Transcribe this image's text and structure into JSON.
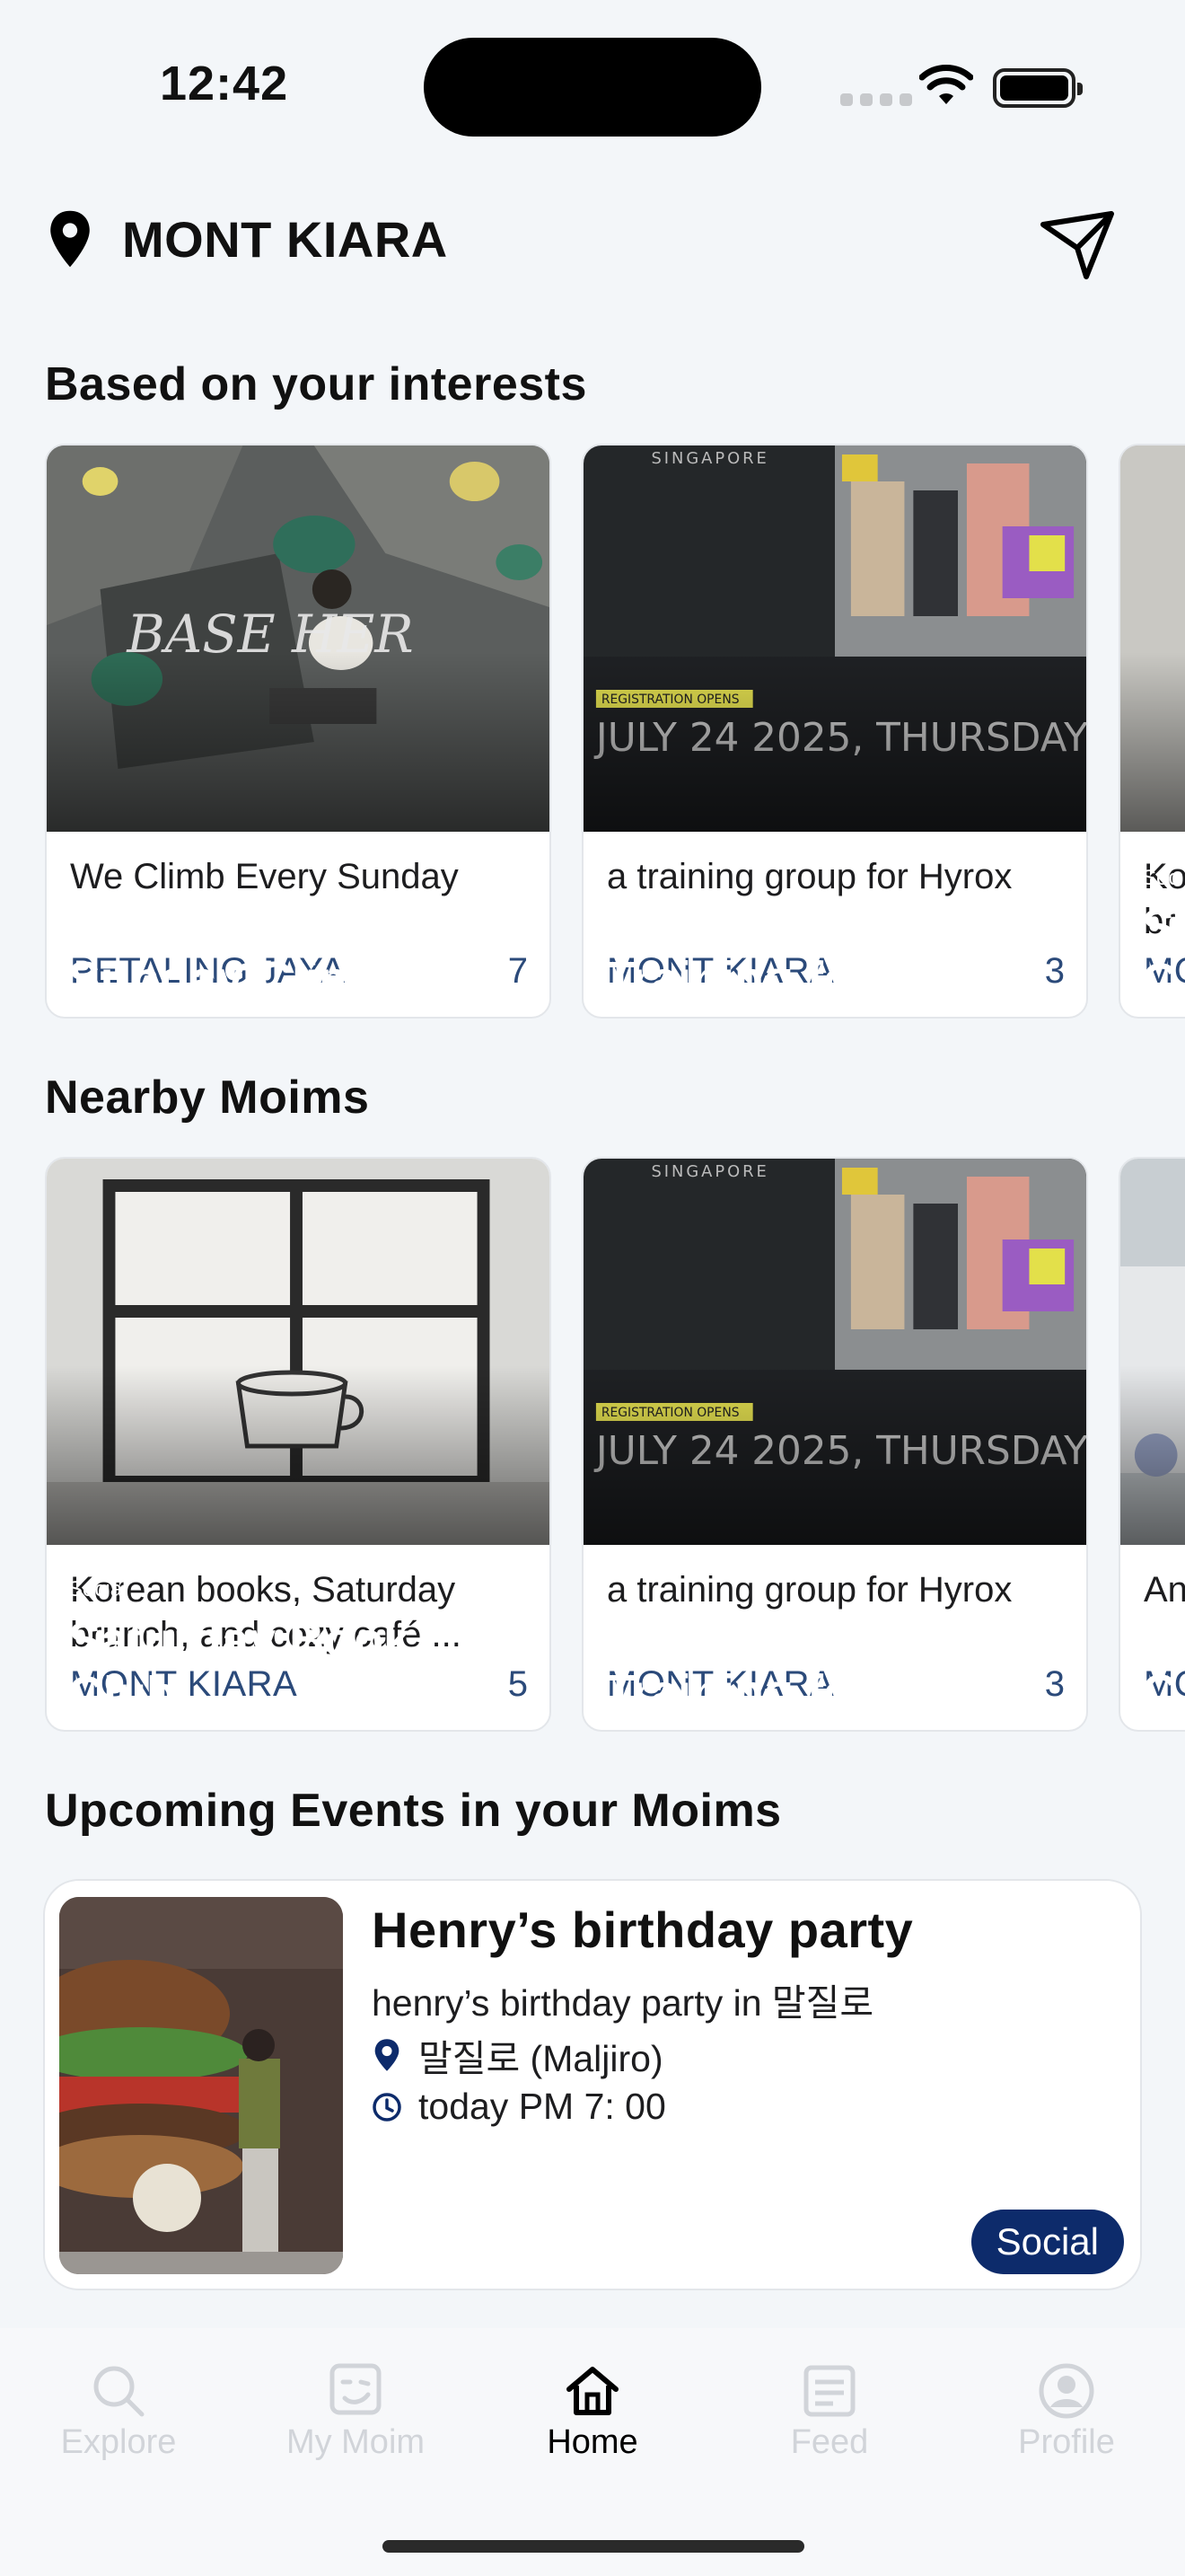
{
  "status_bar": {
    "time": "12:42"
  },
  "header": {
    "location": "MONT KIARA",
    "location_icon": "map-pin-icon",
    "action_icon": "send-icon"
  },
  "sections": {
    "interests_title": "Based on your interests",
    "nearby_title": "Nearby Moims",
    "upcoming_title": "Upcoming Events in your Moims"
  },
  "interest_cards": [
    {
      "category": "Exercise",
      "title": "Sunday Climbing",
      "description": "We Climb Every Sunday",
      "location": "PETALING JAYA",
      "count": "7"
    },
    {
      "category": "Exercise",
      "title": "Training for Hyrox",
      "description": "a training group for Hyrox",
      "location": "MONT KIARA",
      "count": "3",
      "poster_top": "SINGAPORE",
      "poster_badge": "REGISTRATION OPENS",
      "poster_date": "JULY 24 2025, THURSDAY"
    },
    {
      "category": "Soc",
      "title": "Sa C",
      "description": "Ko br",
      "location": "MO"
    }
  ],
  "nearby_cards": [
    {
      "category": "Social",
      "title": "Saturday Book Club",
      "description": "Korean books, Saturday brunch, and cozy café ...",
      "location": "MONT KIARA",
      "count": "5"
    },
    {
      "category": "Exercise",
      "title": "Training for Hyrox",
      "description": "a training group for Hyrox",
      "location": "MONT KIARA",
      "count": "3",
      "poster_top": "SINGAPORE",
      "poster_badge": "REGISTRATION OPENS",
      "poster_date": "JULY 24 2025, THURSDAY"
    },
    {
      "category": "Soc",
      "title": "C",
      "description": "An",
      "location": "MO"
    }
  ],
  "event": {
    "title": "Henry’s birthday party",
    "description": "henry’s birthday party in 말질로",
    "place": "말질로 (Maljiro)",
    "time": "today PM 7: 00",
    "tag": "Social"
  },
  "tabs": [
    {
      "label": "Explore",
      "icon": "search-icon",
      "active": false
    },
    {
      "label": "My Moim",
      "icon": "mymoim-icon",
      "active": false
    },
    {
      "label": "Home",
      "icon": "home-icon",
      "active": true
    },
    {
      "label": "Feed",
      "icon": "feed-icon",
      "active": false
    },
    {
      "label": "Profile",
      "icon": "profile-icon",
      "active": false
    }
  ],
  "colors": {
    "accent": "#0d2b6b",
    "location_text": "#2b4a7a",
    "background": "#f3f6f9"
  }
}
